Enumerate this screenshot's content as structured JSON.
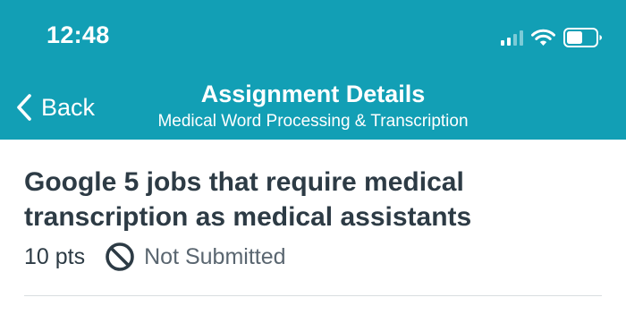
{
  "colors": {
    "header_bg": "#129fb5",
    "header_text": "#ffffff",
    "title_text": "#2d3b45",
    "muted_text": "#5a6670",
    "divider": "#d9dde0",
    "signal_dim": "#7ccbd7"
  },
  "status_bar": {
    "time": "12:48",
    "icons": [
      "cellular-signal-icon",
      "wifi-icon",
      "battery-icon"
    ]
  },
  "nav": {
    "back_label": "Back",
    "title": "Assignment Details",
    "subtitle": "Medical Word Processing & Transcription"
  },
  "assignment": {
    "title": "Google 5 jobs that require medical transcription as medical assistants",
    "points": "10 pts",
    "status": "Not Submitted",
    "status_icon": "no-symbol-icon"
  }
}
